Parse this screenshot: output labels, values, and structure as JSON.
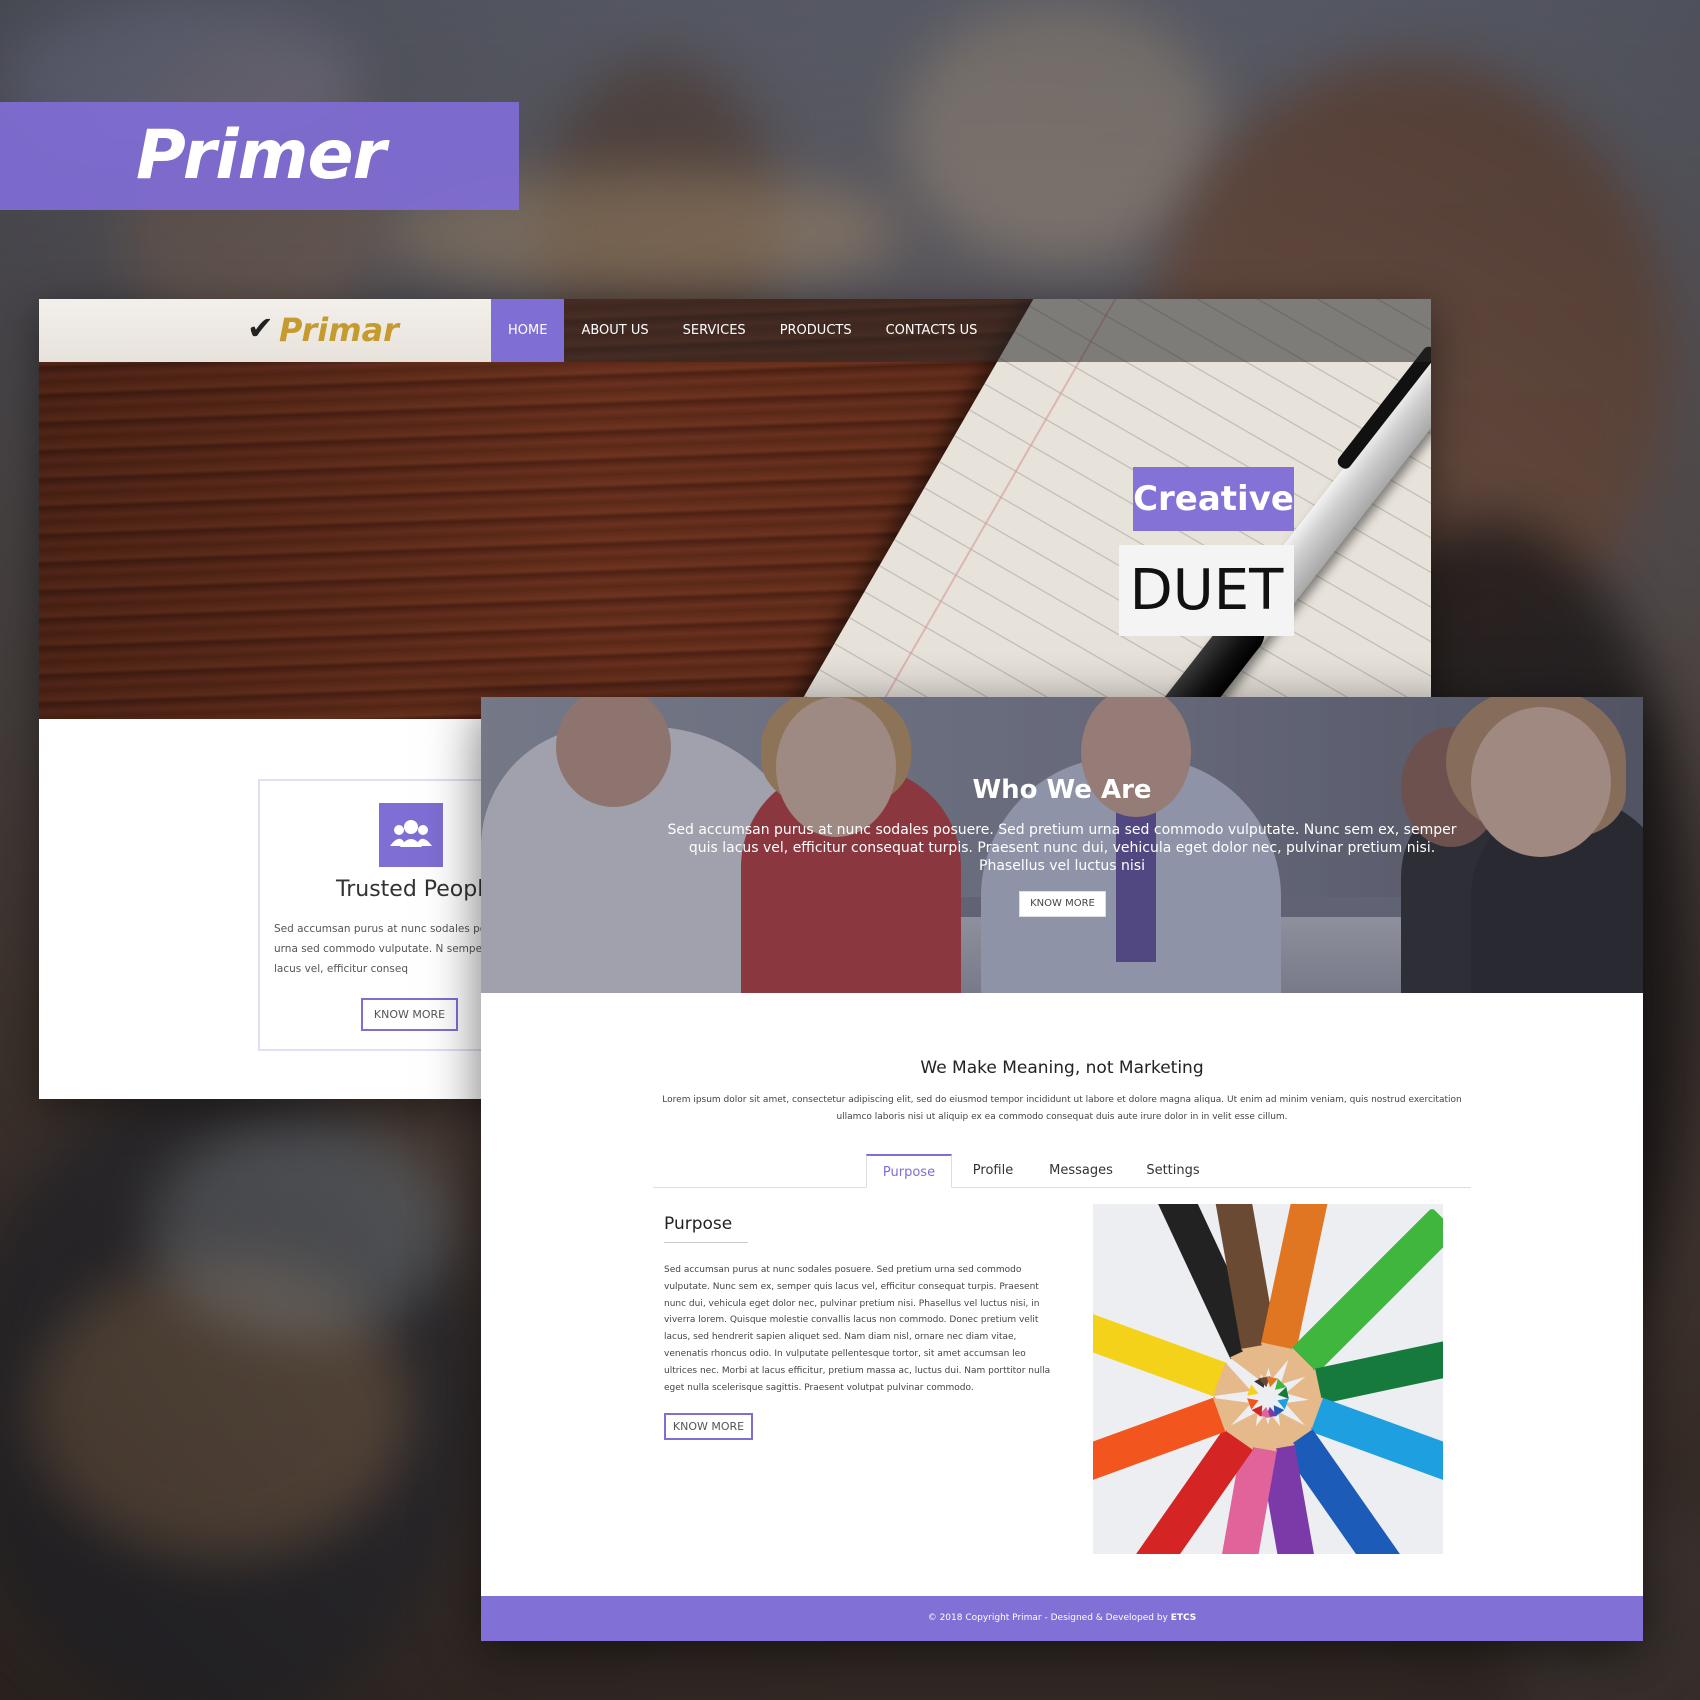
{
  "banner": {
    "title": "Primer"
  },
  "screenshot1": {
    "brand": {
      "check_icon": "check-icon",
      "name": "Primar"
    },
    "nav": [
      "HOME",
      "ABOUT US",
      "SERVICES",
      "PRODUCTS",
      "CONTACTS US"
    ],
    "active_nav": "HOME",
    "hero": {
      "line1": "Creative",
      "line2": "DUET"
    },
    "card": {
      "icon": "users-icon",
      "title": "Trusted People",
      "text": "Sed accumsan purus at nunc sodales pc pretium urna sed commodo vulputate. N semper quis lacus vel, efficitur conseq",
      "button": "KNOW MORE"
    }
  },
  "screenshot2": {
    "hero": {
      "title": "Who We Are",
      "text": "Sed accumsan purus at nunc sodales posuere. Sed pretium urna sed commodo vulputate. Nunc sem ex, semper quis lacus vel, efficitur consequat turpis. Praesent nunc dui, vehicula eget dolor nec, pulvinar pretium nisi. Phasellus vel luctus nisi",
      "button": "KNOW MORE"
    },
    "meaning": {
      "title": "We Make Meaning, not Marketing",
      "text": "Lorem ipsum dolor sit amet, consectetur adipiscing elit, sed do eiusmod tempor incididunt ut labore et dolore magna aliqua. Ut enim ad minim veniam, quis nostrud exercitation ullamco laboris nisi ut aliquip ex ea commodo consequat duis aute irure dolor in in velit esse cillum."
    },
    "tabs": [
      "Purpose",
      "Profile",
      "Messages",
      "Settings"
    ],
    "active_tab": "Purpose",
    "purpose": {
      "heading": "Purpose",
      "text": "Sed accumsan purus at nunc sodales posuere. Sed pretium urna sed commodo vulputate. Nunc sem ex, semper quis lacus vel, efficitur consequat turpis. Praesent nunc dui, vehicula eget dolor nec, pulvinar pretium nisi. Phasellus vel luctus nisi, in viverra lorem. Quisque molestie convallis lacus non commodo. Donec pretium velit lacus, sed hendrerit sapien aliquet sed. Nam diam nisl, ornare nec diam vitae, venenatis rhoncus odio. In vulputate pellentesque tortor, sit amet accumsan leo ultrices nec. Morbi at lacus efficitur, pretium massa ac, luctus dui. Nam porttitor nulla eget nulla scelerisque sagittis. Praesent volutpat pulvinar commodo.",
      "button": "KNOW MORE"
    },
    "footer": {
      "prefix": "© 2018 Copyright Primar - Designed & Developed by ",
      "company": "ETCS"
    }
  },
  "colors": {
    "accent": "#7f6ed4",
    "brand_gold": "#c59a2e"
  }
}
